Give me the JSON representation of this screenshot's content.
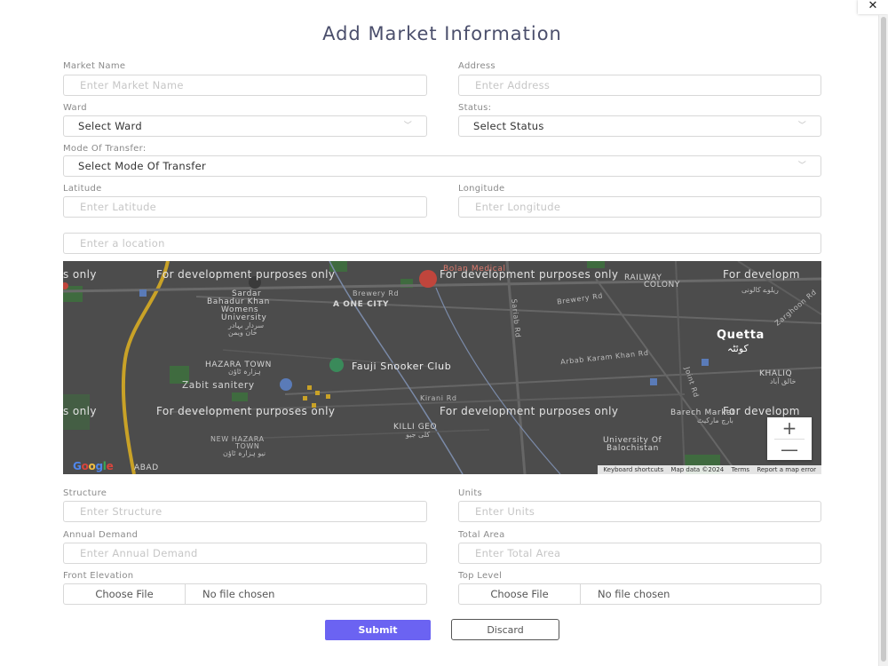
{
  "dialog": {
    "title": "Add Market Information",
    "close_glyph": "✕"
  },
  "form": {
    "market_name": {
      "label": "Market Name",
      "placeholder": "Enter Market Name"
    },
    "address": {
      "label": "Address",
      "placeholder": "Enter Address"
    },
    "ward": {
      "label": "Ward",
      "selected": "Select Ward"
    },
    "status": {
      "label": "Status:",
      "selected": "Select Status"
    },
    "mode_of_transfer": {
      "label": "Mode Of Transfer:",
      "selected": "Select Mode Of Transfer"
    },
    "latitude": {
      "label": "Latitude",
      "placeholder": "Enter Latitude"
    },
    "longitude": {
      "label": "Longitude",
      "placeholder": "Enter Longitude"
    },
    "location_search": {
      "placeholder": "Enter a location"
    },
    "structure": {
      "label": "Structure",
      "placeholder": "Enter Structure"
    },
    "units": {
      "label": "Units",
      "placeholder": "Enter Units"
    },
    "annual_demand": {
      "label": "Annual Demand",
      "placeholder": "Enter Annual Demand"
    },
    "total_area": {
      "label": "Total Area",
      "placeholder": "Enter Total Area"
    },
    "front_elevation": {
      "label": "Front Elevation",
      "button": "Choose File",
      "status": "No file chosen"
    },
    "top_level": {
      "label": "Top Level",
      "button": "Choose File",
      "status": "No file chosen"
    }
  },
  "map": {
    "watermark": "For development purposes only",
    "watermark_partial_left": "s only",
    "watermark_partial_right": "For developm",
    "labels": {
      "bolan_medical": "Bolan Medical",
      "sardar": "Sardar",
      "bahadur": "Bahadur Khan",
      "womens": "Womens",
      "university": "University",
      "urdu_sbk": "سردار بہادر",
      "urdu_uni": "خان ویمن",
      "urdu_uni2": "یونیورسٹی",
      "brewery_rd": "Brewery Rd",
      "brewery_rd2": "Brewery Rd",
      "a_one_city": "A ONE CITY",
      "railway": "RAILWAY",
      "colony": "COLONY",
      "urdu_colony": "ریلوے کالونی",
      "quetta": "Quetta",
      "quetta_urdu": "کوئٹہ",
      "hazara_town": "HAZARA TOWN",
      "hazara_urdu": "ہزارہ ٹاؤن",
      "fauji": "Fauji Snooker Club",
      "arbab": "Arbab Karam Khan Rd",
      "zabit": "Zabit sanitery",
      "khaliq": "KHALIQ",
      "khaliq_urdu": "خالق آباد",
      "kirani": "Kirani Rd",
      "killi_geo": "KILLI GEO",
      "killi_geo_urdu": "کلی جیو",
      "barech": "Barech Market",
      "barech_urdu": "بارچ مارکیٹ",
      "new_hazara": "NEW HAZARA",
      "town": "TOWN",
      "new_hazara_urdu": "نیو ہزارہ ٹاؤن",
      "uni_balochistan": "University Of",
      "uni_balochistan2": "Balochistan",
      "abad": "ABAD",
      "satellite_rd": "Sariab Rd",
      "joint_rd": "Joint Rd",
      "zarghoon": "Zarghoon Rd"
    },
    "zoom_in": "+",
    "zoom_out": "—",
    "attribution": {
      "keyboard": "Keyboard shortcuts",
      "map_data": "Map data ©2024",
      "terms": "Terms",
      "report": "Report a map error"
    },
    "google": "Google",
    "colors": {
      "background": "#4c4c4c",
      "road_major": "#c9a227",
      "park": "#3f6b3f",
      "water": "#7a8aa8",
      "marker_green": "#3a8a5a",
      "marker_red": "#c0453c"
    }
  },
  "buttons": {
    "submit": "Submit",
    "discard": "Discard"
  },
  "colors": {
    "submit_bg": "#6b63f2",
    "title": "#4b4f6c"
  }
}
